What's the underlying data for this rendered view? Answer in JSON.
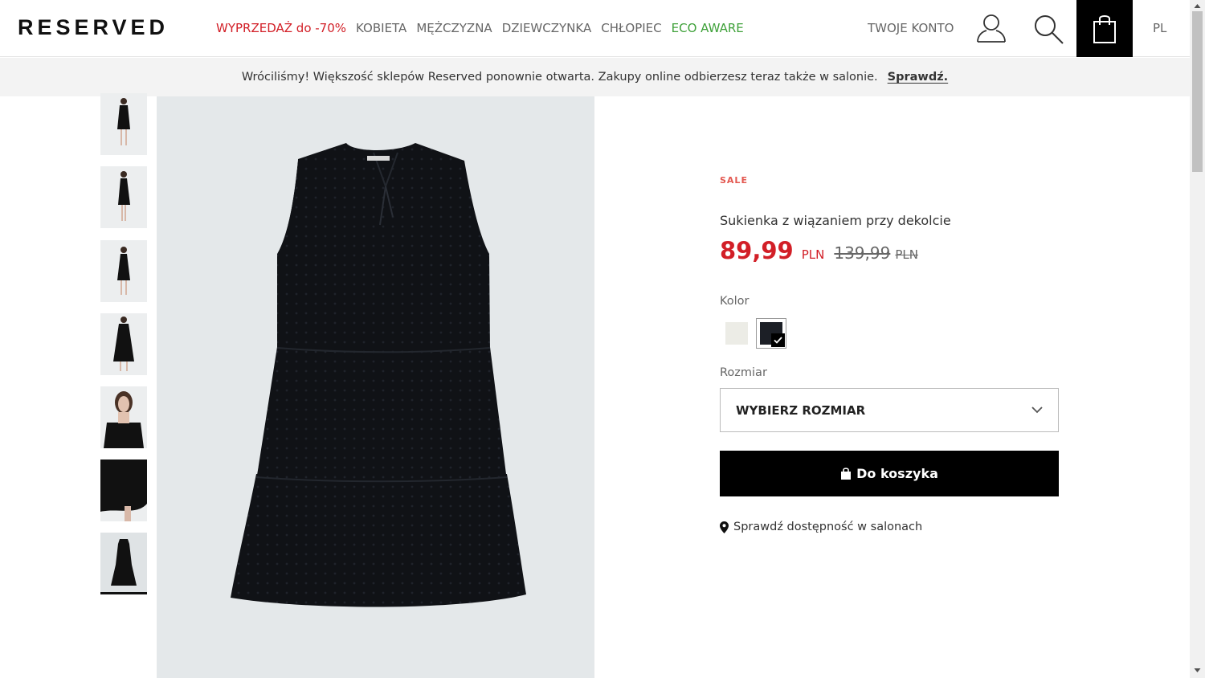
{
  "header": {
    "logo": "RESERVED",
    "nav": [
      {
        "label": "WYPRZEDAŻ do -70%",
        "style": "sale"
      },
      {
        "label": "KOBIETA",
        "style": "normal"
      },
      {
        "label": "MĘŻCZYZNA",
        "style": "normal"
      },
      {
        "label": "DZIEWCZYNKA",
        "style": "normal"
      },
      {
        "label": "CHŁOPIEC",
        "style": "normal"
      },
      {
        "label": "ECO AWARE",
        "style": "eco"
      }
    ],
    "account_label": "TWOJE KONTO",
    "icons": [
      "user-icon",
      "search-icon",
      "shopping-bag-icon"
    ],
    "language": "PL"
  },
  "banner": {
    "text": "Wróciliśmy! Większość sklepów Reserved ponownie otwarta. Zakupy online odbierzesz teraz także w salonie.",
    "link": "Sprawdź."
  },
  "gallery": {
    "thumbnails": [
      "full-body-front",
      "full-body-side",
      "full-body-back",
      "full-body-walking",
      "close-up-neckline",
      "detail-hem",
      "flat-lay"
    ],
    "active_index": 6
  },
  "product": {
    "tag": "SALE",
    "name": "Sukienka z wiązaniem przy dekolcie",
    "price_new": "89,99",
    "price_new_currency": "PLN",
    "price_old": "139,99",
    "price_old_currency": "PLN",
    "color_label": "Kolor",
    "colors": [
      {
        "name": "ecru",
        "hex": "#ecece6"
      },
      {
        "name": "black",
        "hex": "#1c1f26"
      }
    ],
    "selected_color_index": 1,
    "size_label": "Rozmiar",
    "size_placeholder": "WYBIERZ ROZMIAR",
    "add_to_cart": "Do koszyka",
    "store_availability": "Sprawdź dostępność w salonach"
  },
  "colors": {
    "sale_red": "#d21f27",
    "eco_green": "#3fa13a",
    "sale_tag": "#e3574f"
  }
}
